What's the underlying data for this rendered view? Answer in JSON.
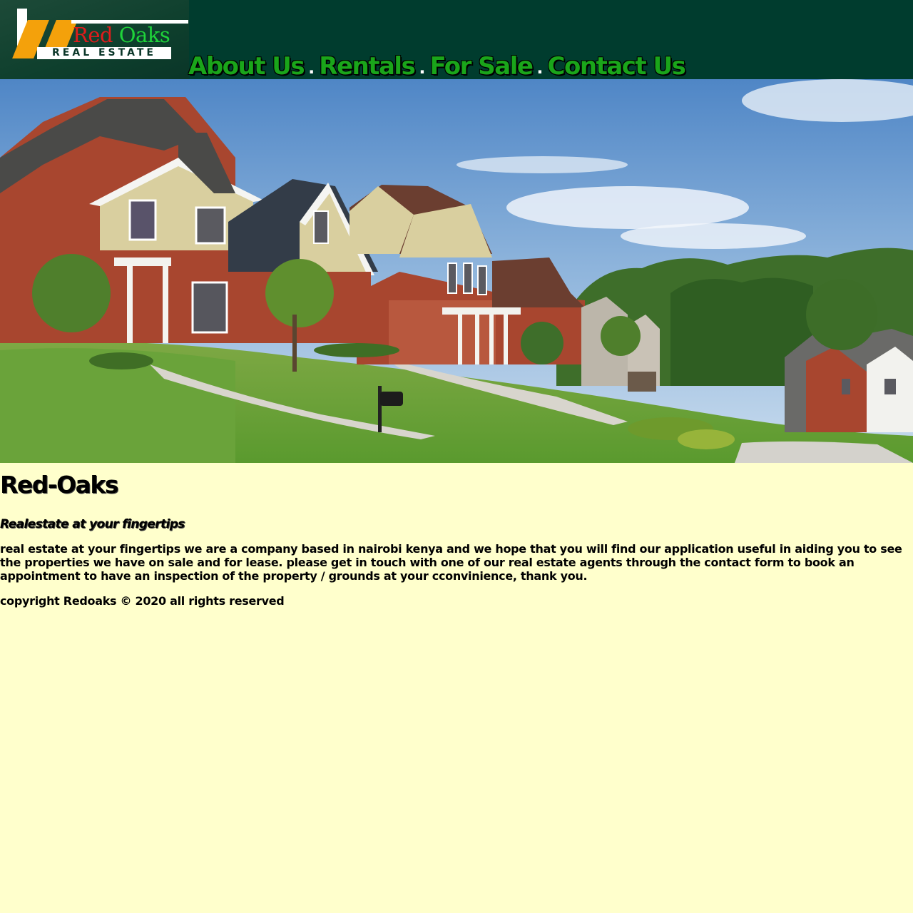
{
  "logo": {
    "brand_red": "Red",
    "brand_green": "Oaks",
    "tagline": "REAL ESTATE"
  },
  "nav": {
    "items": [
      {
        "label": "About Us"
      },
      {
        "label": "Rentals"
      },
      {
        "label": "For Sale"
      },
      {
        "label": "Contact Us"
      }
    ],
    "separator": "."
  },
  "main": {
    "title": "Red-Oaks",
    "subtitle": "Realestate at your fingertips",
    "description": "real estate at your fingertips we are a company based in nairobi kenya and we hope that you will find our application useful in aiding you to see the properties we have on sale and for lease. please get in touch with one of our real estate agents through the contact form to book an appointment to have an inspection of the property / grounds at your cconvinience, thank you.",
    "copyright": "copyright Redoaks © 2020 all rights reserved"
  },
  "colors": {
    "header_bg": "#003c2e",
    "nav_link": "#1aa51a",
    "page_bg": "#ffffcc",
    "logo_orange": "#f4a10b",
    "logo_red": "#e01c1c",
    "logo_green": "#1fd43a"
  }
}
